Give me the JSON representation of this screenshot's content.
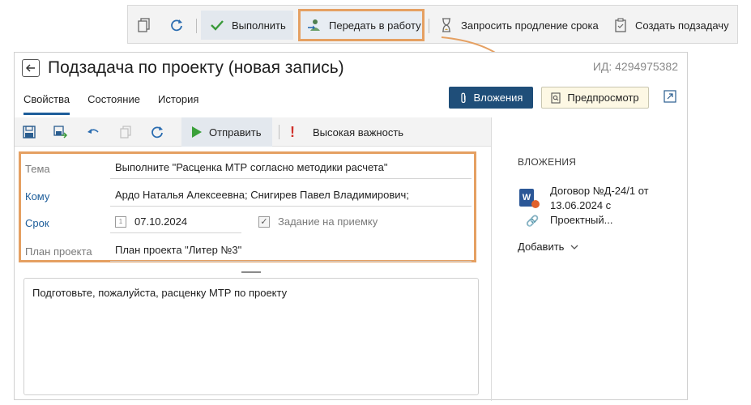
{
  "top_toolbar": {
    "complete_label": "Выполнить",
    "transfer_label": "Передать в работу",
    "extend_label": "Запросить продление срока",
    "subtask_label": "Создать подзадачу"
  },
  "card": {
    "title": "Подзадача по проекту (новая запись)",
    "record_id": "ИД: 4294975382",
    "tabs": [
      {
        "label": "Свойства"
      },
      {
        "label": "Состояние"
      },
      {
        "label": "История"
      }
    ],
    "attachments_button": "Вложения",
    "preview_button": "Предпросмотр"
  },
  "inner_toolbar": {
    "send_label": "Отправить",
    "importance_label": "Высокая важность"
  },
  "form": {
    "subject_label": "Тема",
    "subject_value": "Выполните \"Расценка МТР согласно методики расчета\"",
    "to_label": "Кому",
    "to_value": "Ардо Наталья Алексеевна; Снигирев Павел Владимирович;",
    "due_label": "Срок",
    "due_value": "07.10.2024",
    "acceptance_label": "Задание на приемку",
    "project_label": "План проекта",
    "project_value": "План проекта \"Литер №3\""
  },
  "comment": "Подготовьте, пожалуйста, расценку МТР по проекту",
  "attachments_panel": {
    "title": "ВЛОЖЕНИЯ",
    "item_text": "Договор №Д-24/1 от 13.06.2024 с Проектный...",
    "add_label": "Добавить"
  },
  "colors": {
    "highlight": "#e5a062",
    "primary": "#1f4e79",
    "link": "#1d5d9a"
  }
}
